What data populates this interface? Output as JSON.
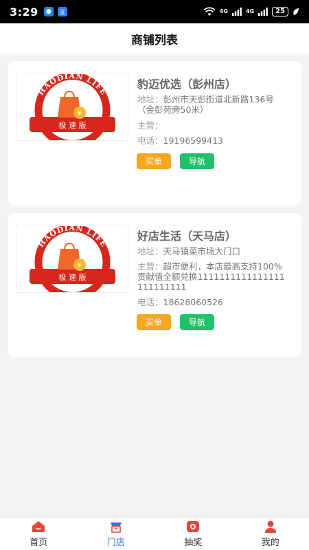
{
  "status_bar": {
    "time": "3:29",
    "signal_1": "4G",
    "signal_2": "4G",
    "battery": "25",
    "notif_2": "支"
  },
  "header": {
    "title": "商铺列表"
  },
  "logo_text": {
    "arc": "HAODIAN LIFE",
    "ribbon": "极 速 版"
  },
  "stores": [
    {
      "name": "豹迈优选（彭州店）",
      "address_label": "地址：",
      "address": "彭州市天彭街道北新路136号 （金彭苑旁50米）",
      "main_label": "主营：",
      "main": "",
      "phone_label": "电话：",
      "phone": "19196599413",
      "buy_label": "买单",
      "nav_label": "导航"
    },
    {
      "name": "好店生活（天马店）",
      "address_label": "地址：",
      "address": "天马镇菜市场大门口",
      "main_label": "主营：",
      "main": "超市便利，本店最高支持100%贡献值全额兑换1111111111111111111111111",
      "phone_label": "电话：",
      "phone": "18628060526",
      "buy_label": "买单",
      "nav_label": "导航"
    }
  ],
  "bottom_nav": [
    {
      "label": "首页",
      "icon": "home-icon"
    },
    {
      "label": "门店",
      "icon": "store-icon",
      "active": true
    },
    {
      "label": "抽奖",
      "icon": "lottery-icon"
    },
    {
      "label": "我的",
      "icon": "profile-icon"
    }
  ],
  "colors": {
    "buy_button": "#f5a623",
    "nav_button": "#21c16b",
    "active_tab": "#2f73e8",
    "logo_red": "#d9261c"
  }
}
